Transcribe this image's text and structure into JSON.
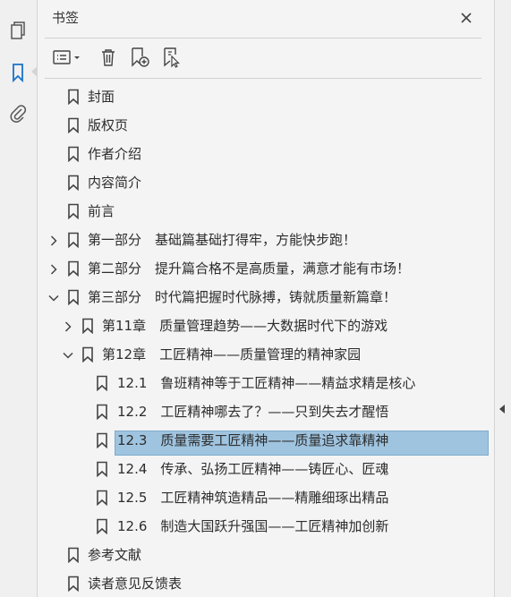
{
  "panel": {
    "title": "书签"
  },
  "rail": {
    "icons": [
      "pages-icon",
      "bookmark-icon",
      "attachment-icon"
    ]
  },
  "toolbar": {
    "buttons": [
      "options-menu-icon",
      "delete-bookmark-icon",
      "new-bookmark-icon",
      "bookmark-from-selection-icon"
    ]
  },
  "bookmarks": [
    {
      "label": "封面"
    },
    {
      "label": "版权页"
    },
    {
      "label": "作者介绍"
    },
    {
      "label": "内容简介"
    },
    {
      "label": "前言"
    },
    {
      "label": "第一部分　基础篇基础打得牢，方能快步跑！",
      "expanded": false
    },
    {
      "label": "第二部分　提升篇合格不是高质量，满意才能有市场！",
      "expanded": false
    },
    {
      "label": "第三部分　时代篇把握时代脉搏，铸就质量新篇章！",
      "expanded": true
    },
    {
      "label": "第11章　质量管理趋势——大数据时代下的游戏",
      "expanded": false
    },
    {
      "label": "第12章　工匠精神——质量管理的精神家园",
      "expanded": true
    },
    {
      "label": "12.1　鲁班精神等于工匠精神——精益求精是核心"
    },
    {
      "label": "12.2　工匠精神哪去了？——只到失去才醒悟"
    },
    {
      "label": "12.3　质量需要工匠精神——质量追求靠精神",
      "selected": true
    },
    {
      "label": "12.4　传承、弘扬工匠精神——铸匠心、匠魂"
    },
    {
      "label": "12.5　工匠精神筑造精品——精雕细琢出精品"
    },
    {
      "label": "12.6　制造大国跃升强国——工匠精神加创新"
    },
    {
      "label": "参考文献"
    },
    {
      "label": "读者意见反馈表"
    }
  ],
  "colors": {
    "selection": "#9fc4e0",
    "accent": "#1a73c8"
  }
}
